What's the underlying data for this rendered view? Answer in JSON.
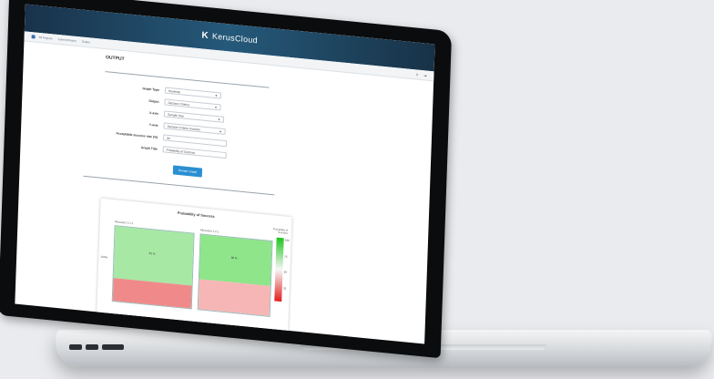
{
  "app": {
    "brand": "KerusCloud",
    "brand_mark": "K"
  },
  "breadcrumbs": [
    "All Projects",
    "Current Project",
    "Output"
  ],
  "toolbar": {
    "help_label": "?",
    "export_label": "⇥"
  },
  "page": {
    "title": "OUTPUT"
  },
  "form": {
    "graph_type": {
      "label": "Graph Type",
      "value": "Heatmap"
    },
    "output": {
      "label": "Output",
      "value": "Decision Criteria"
    },
    "x_axis": {
      "label": "X-axis",
      "value": "Sample Size"
    },
    "y_axis": {
      "label": "Y-axis",
      "value": "Decision Criteria Success"
    },
    "acceptable_rate": {
      "label": "Acceptable success rate (%)",
      "value": "80"
    },
    "graph_title": {
      "label": "Graph Title",
      "value": "Probability of Success"
    },
    "render_button": "Render Graph"
  },
  "chart": {
    "title": "Probability of Success",
    "panel_left": {
      "label": "Allocation 1:1:1",
      "value": "81 %"
    },
    "panel_right": {
      "label": "Allocation 1:2:1",
      "value": "86 %"
    },
    "y_tick": "100%",
    "legend_label": "Probability of Success",
    "legend_ticks": [
      "100",
      "75",
      "50",
      "25"
    ]
  },
  "colors": {
    "topbar": "#19324a",
    "accent": "#2a8fd2",
    "heat_high": "#1ec51e",
    "heat_low": "#e21d1d"
  }
}
